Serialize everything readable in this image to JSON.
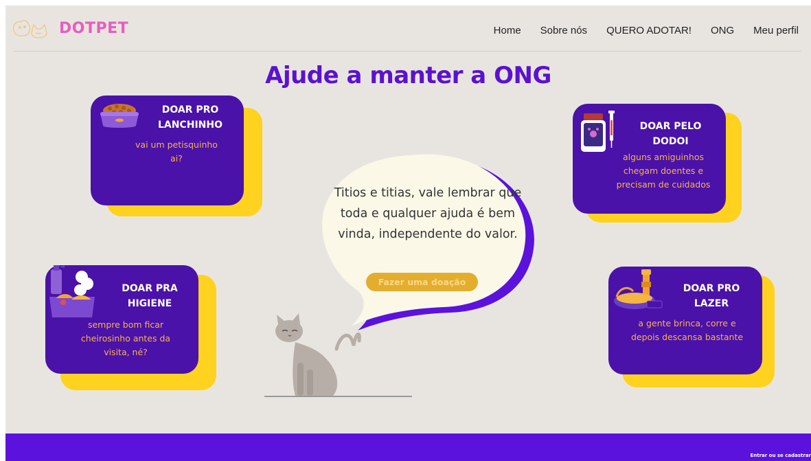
{
  "brand": {
    "name": "DOTPET",
    "color": "#e85dbd"
  },
  "nav": [
    "Home",
    "Sobre nós",
    "QUERO ADOTAR!",
    "ONG",
    "Meu perfil"
  ],
  "page_title": "Ajude a manter a ONG",
  "cards": {
    "lanchinho": {
      "title": "DOAR PRO LANCHINHO",
      "text": "vai um petisquinho ai?",
      "icon": "food-bowl-icon"
    },
    "dodoi": {
      "title": "DOAR PELO DODOI",
      "text": "alguns amiguinhos chegam doentes e precisam de cuidados",
      "icon": "medicine-icon"
    },
    "higiene": {
      "title": "DOAR PRA HIGIENE",
      "text": "sempre bom ficar cheirosinho antes da visita, né?",
      "icon": "hygiene-kit-icon"
    },
    "lazer": {
      "title": "DOAR PRO LAZER",
      "text": "a gente brinca, corre e depois descansa bastante",
      "icon": "cat-bed-icon"
    }
  },
  "bubble": {
    "text": "Titios e titias, vale lembrar que toda e qualquer ajuda é bem vinda, independente do valor.",
    "button": "Fazer uma doação"
  },
  "footer": {
    "signin": "Entrar ou se cadastrar"
  },
  "colors": {
    "purple": "#4a12a8",
    "title_purple": "#5b12cf",
    "yellow": "#ffd21f",
    "orange_text": "#f7b34a",
    "background": "#e8e5e1"
  }
}
